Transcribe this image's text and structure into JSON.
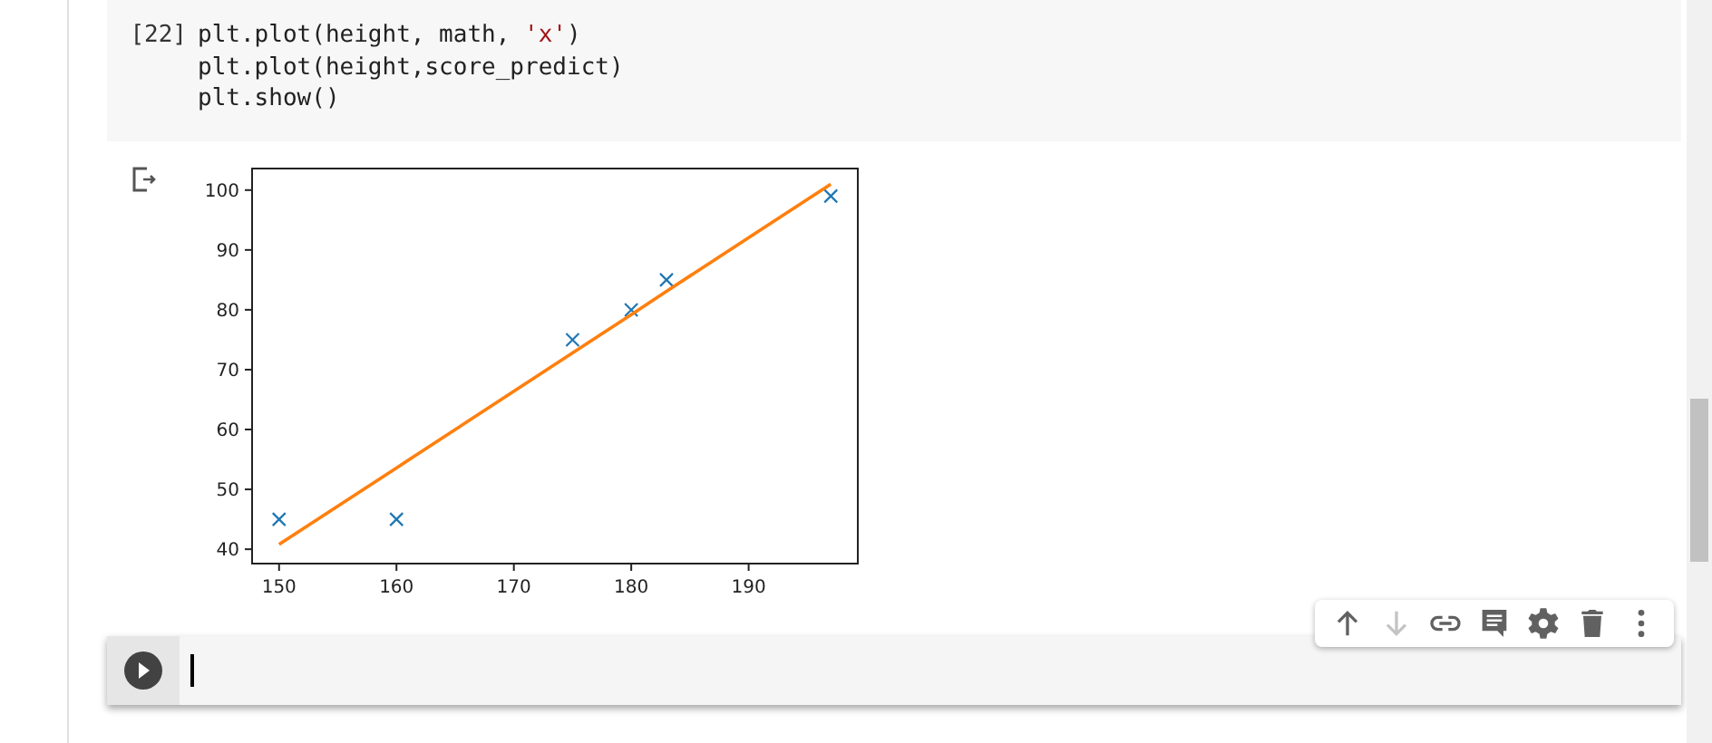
{
  "code_cell": {
    "execution_count": "[22]",
    "lines": [
      [
        {
          "kind": "plain",
          "text": "plt.plot(height, math, "
        },
        {
          "kind": "string",
          "text": "'x'"
        },
        {
          "kind": "plain",
          "text": ")"
        }
      ],
      [
        {
          "kind": "plain",
          "text": "plt.plot(height,score_predict)"
        }
      ],
      [
        {
          "kind": "plain",
          "text": "plt.show()"
        }
      ]
    ]
  },
  "output": {
    "chart_data": {
      "type": "line",
      "x": [
        150,
        160,
        175,
        180,
        183,
        197
      ],
      "series": [
        {
          "type": "scatter",
          "color": "#1f77b4",
          "marker": "x",
          "values": [
            45,
            45,
            75,
            80,
            85,
            99
          ]
        },
        {
          "type": "line",
          "color": "#ff7f0e",
          "values": [
            40.8,
            53.6,
            72.8,
            79.2,
            83.1,
            101.0
          ]
        }
      ],
      "xlim": [
        147.7,
        199.3
      ],
      "ylim": [
        37.6,
        103.6
      ],
      "xticks": [
        150,
        160,
        170,
        180,
        190
      ],
      "yticks": [
        40,
        50,
        60,
        70,
        80,
        90,
        100
      ]
    }
  },
  "cell_toolbar": [
    {
      "kind": "up",
      "disabled": false
    },
    {
      "kind": "down",
      "disabled": true
    },
    {
      "kind": "link",
      "disabled": false
    },
    {
      "kind": "comment",
      "disabled": false
    },
    {
      "kind": "settings",
      "disabled": false
    },
    {
      "kind": "delete",
      "disabled": false
    },
    {
      "kind": "more",
      "disabled": false
    }
  ]
}
